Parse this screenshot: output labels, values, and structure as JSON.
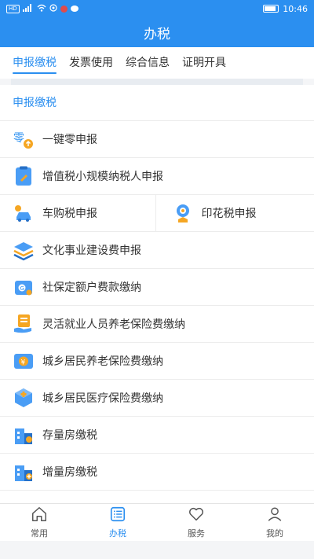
{
  "status": {
    "left_chip": "HD",
    "time": "10:46"
  },
  "header": {
    "title": "办税"
  },
  "tabs": [
    {
      "label": "申报缴税"
    },
    {
      "label": "发票使用"
    },
    {
      "label": "综合信息"
    },
    {
      "label": "证明开具"
    }
  ],
  "section": {
    "title": "申报缴税"
  },
  "items": [
    {
      "label": "一键零申报",
      "icon": "zero-report-icon"
    },
    {
      "label": "增值税小规模纳税人申报",
      "icon": "clipboard-edit-icon"
    },
    {
      "label": "车购税申报",
      "icon": "car-icon"
    },
    {
      "label": "印花税申报",
      "icon": "stamp-icon"
    },
    {
      "label": "文化事业建设费申报",
      "icon": "layers-icon"
    },
    {
      "label": "社保定额户费款缴纳",
      "icon": "wallet-icon"
    },
    {
      "label": "灵活就业人员养老保险费缴纳",
      "icon": "hand-document-icon"
    },
    {
      "label": "城乡居民养老保险费缴纳",
      "icon": "yuan-wallet-icon"
    },
    {
      "label": "城乡居民医疗保险费缴纳",
      "icon": "medical-box-icon"
    },
    {
      "label": "存量房缴税",
      "icon": "building-icon"
    },
    {
      "label": "增量房缴税",
      "icon": "building-plus-icon"
    }
  ],
  "nav": [
    {
      "label": "常用",
      "icon": "home-icon"
    },
    {
      "label": "办税",
      "icon": "list-icon"
    },
    {
      "label": "服务",
      "icon": "heart-icon"
    },
    {
      "label": "我的",
      "icon": "user-icon"
    }
  ],
  "colors": {
    "primary": "#2b8ff0",
    "text": "#333333",
    "divider": "#ececec"
  }
}
